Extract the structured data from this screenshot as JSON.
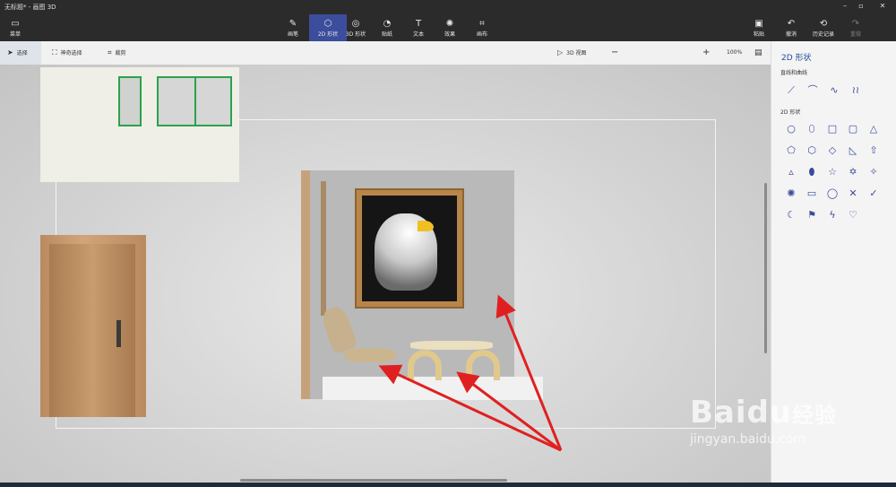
{
  "titlebar": {
    "title": "无标题* - 画图 3D"
  },
  "ribbon": {
    "menu_label": "菜单",
    "tools": [
      {
        "id": "brushes",
        "label": "画笔",
        "icon": "✎"
      },
      {
        "id": "2dshape",
        "label": "2D 形状",
        "icon": "⬡"
      },
      {
        "id": "3dshape",
        "label": "3D 形状",
        "icon": "◎"
      },
      {
        "id": "sticker",
        "label": "贴纸",
        "icon": "◔"
      },
      {
        "id": "text",
        "label": "文本",
        "icon": "T"
      },
      {
        "id": "effects",
        "label": "效果",
        "icon": "✺"
      },
      {
        "id": "canvas",
        "label": "画布",
        "icon": "⌗"
      }
    ],
    "paste_label": "粘贴",
    "undo_label": "撤消",
    "history_label": "历史记录",
    "redo_label": "重做"
  },
  "subbar": {
    "select_label": "选择",
    "magic_select_label": "神奇选择",
    "crop_label": "裁剪",
    "view3d_label": "3D 视图",
    "zoom_text": "100%",
    "zoom_fraction": 0.5
  },
  "panel": {
    "title": "2D 形状",
    "lines_title": "直线和曲线",
    "shapes_title": "2D 形状",
    "line_icons": [
      "line-icon",
      "arc-icon",
      "wave-icon",
      "squiggle-icon"
    ],
    "shape_icons": [
      "circle-icon",
      "capsule-icon",
      "square-icon",
      "rounded-square-icon",
      "triangle-icon",
      "pentagon-icon",
      "hexagon-icon",
      "diamond-icon",
      "right-triangle-icon",
      "arrow-up-icon",
      "triangle-outline-icon",
      "leaf-icon",
      "star5-icon",
      "star6-icon",
      "star4-icon",
      "burst-icon",
      "speech-rect-icon",
      "speech-oval-icon",
      "cross-icon",
      "check-icon",
      "moon-icon",
      "banner-icon",
      "lightning-icon",
      "heart-icon"
    ]
  },
  "colors": {
    "accent": "#3b4d9c",
    "shape_blue": "#3a4c9a",
    "arrow_red": "#e02020"
  },
  "watermark": {
    "brand": "Baidu",
    "brand_cn": "经验",
    "url": "jingyan.baidu.com"
  }
}
